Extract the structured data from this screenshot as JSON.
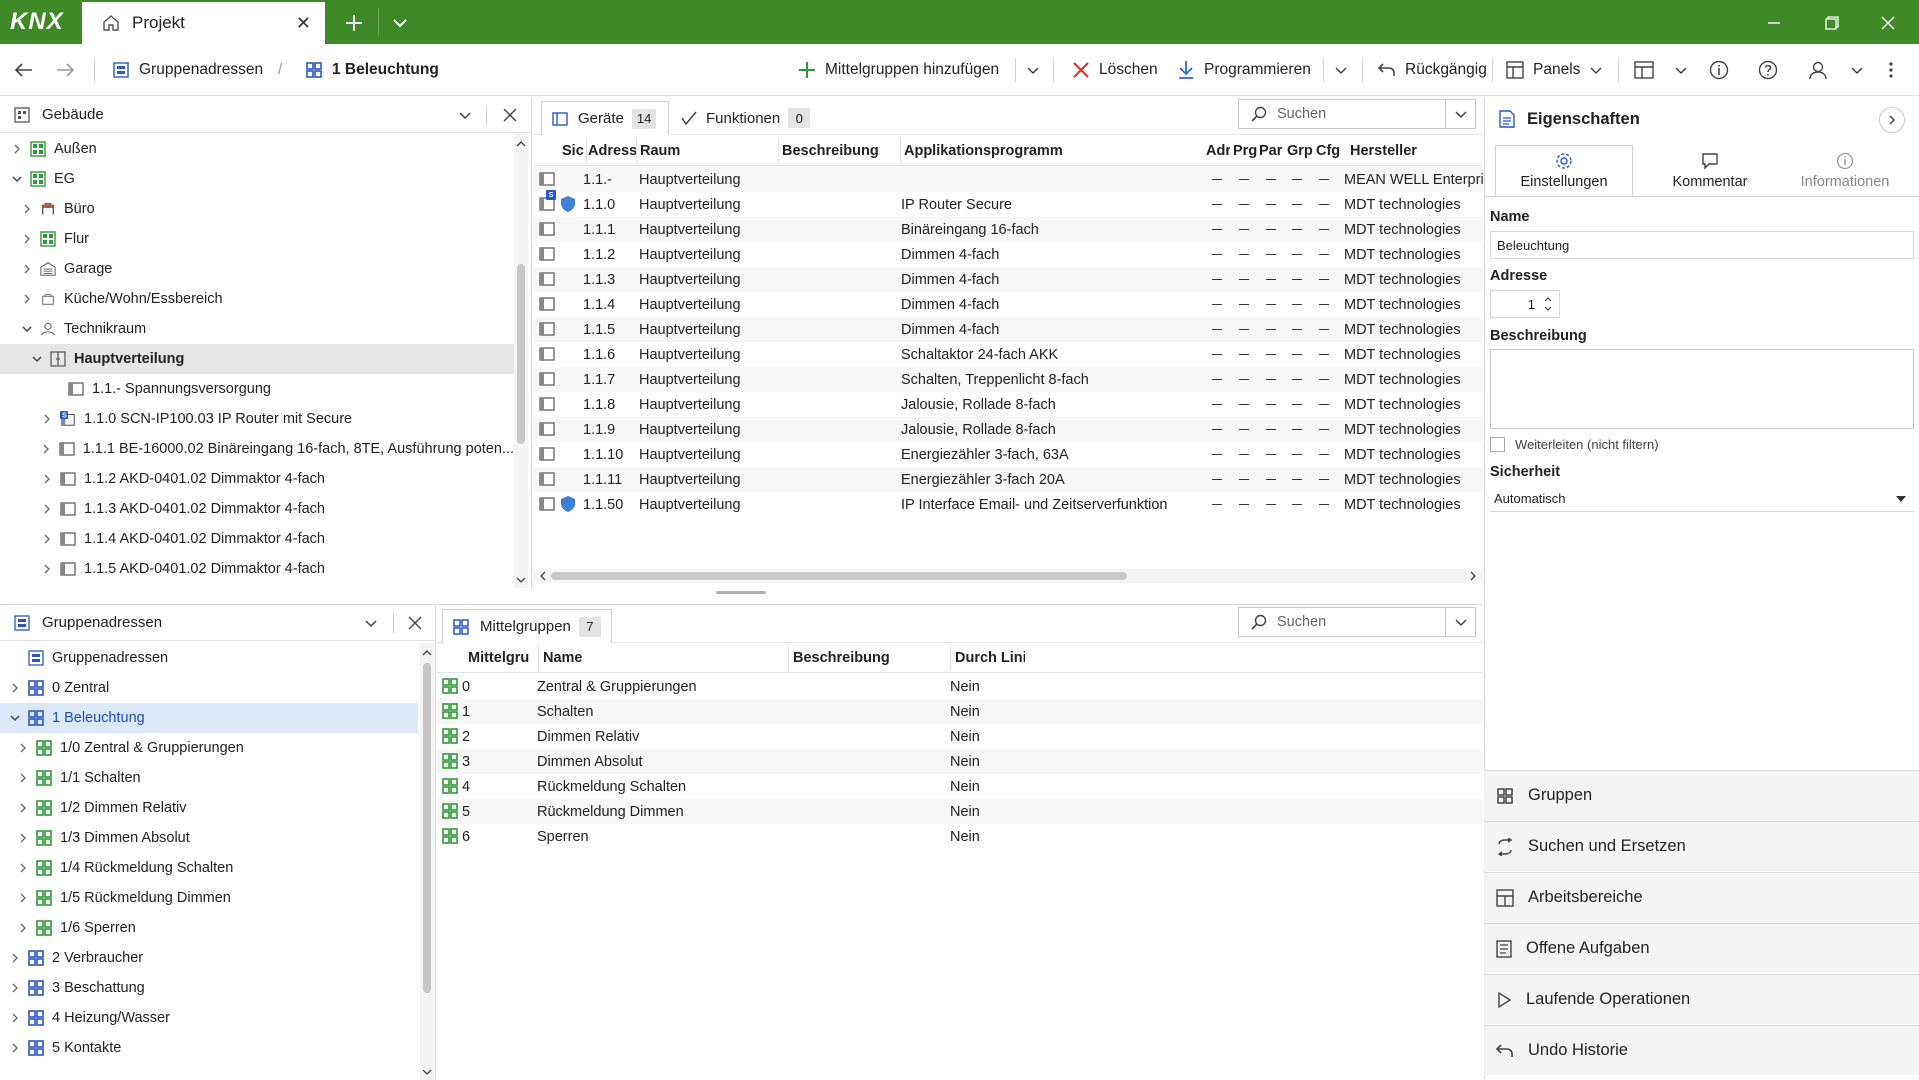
{
  "app": {
    "logo": "KNX",
    "tab_title": "Projekt"
  },
  "toolbar": {
    "breadcrumb_root": "Gruppenadressen",
    "breadcrumb_current": "1 Beleuchtung",
    "add_label": "Mittelgruppen hinzufügen",
    "delete_label": "Löschen",
    "program_label": "Programmieren",
    "undo_label": "Rückgängig",
    "panels_label": "Panels"
  },
  "building": {
    "title": "Gebäude",
    "items": [
      {
        "label": "Außen"
      },
      {
        "label": "EG"
      },
      {
        "label": "Büro"
      },
      {
        "label": "Flur"
      },
      {
        "label": "Garage"
      },
      {
        "label": "Küche/Wohn/Essbereich"
      },
      {
        "label": "Technikraum"
      },
      {
        "label": "Hauptverteilung"
      },
      {
        "label": "1.1.- Spannungsversorgung"
      },
      {
        "label": "1.1.0 SCN-IP100.03 IP Router mit Secure"
      },
      {
        "label": "1.1.1 BE-16000.02 Binäreingang 16-fach, 8TE, Ausführung poten..."
      },
      {
        "label": "1.1.2 AKD-0401.02 Dimmaktor 4-fach"
      },
      {
        "label": "1.1.3 AKD-0401.02 Dimmaktor 4-fach"
      },
      {
        "label": "1.1.4 AKD-0401.02 Dimmaktor 4-fach"
      },
      {
        "label": "1.1.5 AKD-0401.02 Dimmaktor 4-fach"
      }
    ]
  },
  "devices": {
    "tab_devices": "Geräte",
    "tab_devices_count": "14",
    "tab_functions": "Funktionen",
    "tab_functions_count": "0",
    "search_placeholder": "Suchen",
    "columns": [
      "Sic",
      "Adresse",
      "Raum",
      "Beschreibung",
      "Applikationsprogramm",
      "Adr",
      "Prg",
      "Par",
      "Grp",
      "Cfg",
      "Hersteller"
    ],
    "rows": [
      {
        "addr": "1.1.-",
        "room": "Hauptverteilung",
        "app": "",
        "maker": "MEAN WELL Enterpri"
      },
      {
        "addr": "1.1.0",
        "room": "Hauptverteilung",
        "app": "IP Router Secure",
        "maker": "MDT technologies"
      },
      {
        "addr": "1.1.1",
        "room": "Hauptverteilung",
        "app": "Binäreingang 16-fach",
        "maker": "MDT technologies"
      },
      {
        "addr": "1.1.2",
        "room": "Hauptverteilung",
        "app": "Dimmen 4-fach",
        "maker": "MDT technologies"
      },
      {
        "addr": "1.1.3",
        "room": "Hauptverteilung",
        "app": "Dimmen 4-fach",
        "maker": "MDT technologies"
      },
      {
        "addr": "1.1.4",
        "room": "Hauptverteilung",
        "app": "Dimmen 4-fach",
        "maker": "MDT technologies"
      },
      {
        "addr": "1.1.5",
        "room": "Hauptverteilung",
        "app": "Dimmen 4-fach",
        "maker": "MDT technologies"
      },
      {
        "addr": "1.1.6",
        "room": "Hauptverteilung",
        "app": "Schaltaktor 24-fach AKK",
        "maker": "MDT technologies"
      },
      {
        "addr": "1.1.7",
        "room": "Hauptverteilung",
        "app": "Schalten, Treppenlicht 8-fach",
        "maker": "MDT technologies"
      },
      {
        "addr": "1.1.8",
        "room": "Hauptverteilung",
        "app": "Jalousie, Rollade 8-fach",
        "maker": "MDT technologies"
      },
      {
        "addr": "1.1.9",
        "room": "Hauptverteilung",
        "app": "Jalousie, Rollade 8-fach",
        "maker": "MDT technologies"
      },
      {
        "addr": "1.1.10",
        "room": "Hauptverteilung",
        "app": "Energiezähler 3-fach, 63A",
        "maker": "MDT technologies"
      },
      {
        "addr": "1.1.11",
        "room": "Hauptverteilung",
        "app": "Energiezähler 3-fach 20A",
        "maker": "MDT technologies"
      },
      {
        "addr": "1.1.50",
        "room": "Hauptverteilung",
        "app": "IP Interface Email- und Zeitserverfunktion",
        "maker": "MDT technologies"
      }
    ]
  },
  "group_addresses": {
    "title": "Gruppenadressen",
    "items": [
      {
        "label": "Gruppenadressen"
      },
      {
        "label": "0 Zentral"
      },
      {
        "label": "1 Beleuchtung"
      },
      {
        "label": "1/0 Zentral & Gruppierungen"
      },
      {
        "label": "1/1 Schalten"
      },
      {
        "label": "1/2 Dimmen Relativ"
      },
      {
        "label": "1/3 Dimmen Absolut"
      },
      {
        "label": "1/4 Rückmeldung Schalten"
      },
      {
        "label": "1/5 Rückmeldung Dimmen"
      },
      {
        "label": "1/6 Sperren"
      },
      {
        "label": "2 Verbraucher"
      },
      {
        "label": "3 Beschattung"
      },
      {
        "label": "4 Heizung/Wasser"
      },
      {
        "label": "5 Kontakte"
      }
    ]
  },
  "middle_groups": {
    "tab_label": "Mittelgruppen",
    "count": "7",
    "search_placeholder": "Suchen",
    "columns": [
      "Mittelgru",
      "Name",
      "Beschreibung",
      "Durch Lini"
    ],
    "rows": [
      {
        "num": "0",
        "name": "Zentral & Gruppierungen",
        "pass": "Nein"
      },
      {
        "num": "1",
        "name": "Schalten",
        "pass": "Nein"
      },
      {
        "num": "2",
        "name": "Dimmen Relativ",
        "pass": "Nein"
      },
      {
        "num": "3",
        "name": "Dimmen Absolut",
        "pass": "Nein"
      },
      {
        "num": "4",
        "name": "Rückmeldung Schalten",
        "pass": "Nein"
      },
      {
        "num": "5",
        "name": "Rückmeldung Dimmen",
        "pass": "Nein"
      },
      {
        "num": "6",
        "name": "Sperren",
        "pass": "Nein"
      }
    ]
  },
  "properties": {
    "title": "Eigenschaften",
    "tab_settings": "Einstellungen",
    "tab_comment": "Kommentar",
    "tab_info": "Informationen",
    "name_label": "Name",
    "name_value": "Beleuchtung",
    "address_label": "Adresse",
    "address_value": "1",
    "description_label": "Beschreibung",
    "forward_label": "Weiterleiten (nicht filtern)",
    "security_label": "Sicherheit",
    "security_value": "Automatisch"
  },
  "side_buttons": [
    "Gruppen",
    "Suchen und Ersetzen",
    "Arbeitsbereiche",
    "Offene Aufgaben",
    "Laufende Operationen",
    "Undo Historie"
  ],
  "colors": {
    "brand": "#3e8a27",
    "group_icon": "#2a57c6",
    "green_icon": "#2f9a37"
  }
}
